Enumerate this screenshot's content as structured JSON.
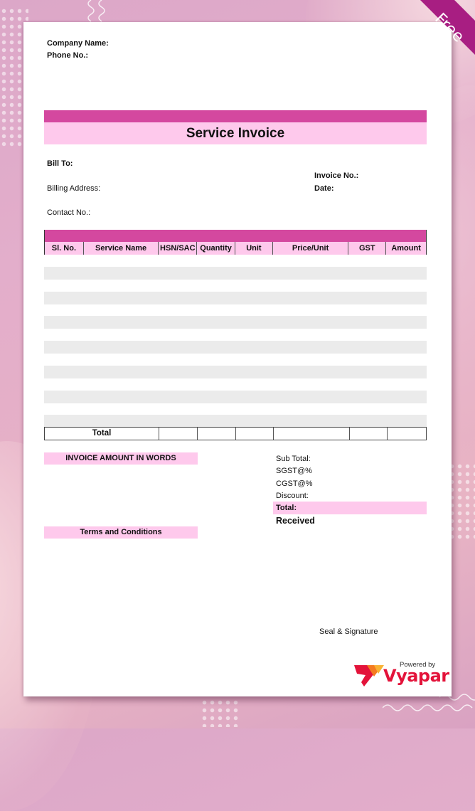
{
  "ribbon": {
    "label": "Free"
  },
  "header": {
    "company_name_label": "Company Name:",
    "phone_label": "Phone No.:"
  },
  "title": "Service Invoice",
  "billing": {
    "bill_to_label": "Bill To:",
    "billing_address_label": "Billing Address:",
    "contact_label": "Contact No.:",
    "invoice_no_label": "Invoice No.:",
    "date_label": "Date:"
  },
  "table": {
    "columns": [
      "Sl. No.",
      "Service Name",
      "HSN/SAC",
      "Quantity",
      "Unit",
      "Price/Unit",
      "GST",
      "Amount"
    ],
    "empty_rows": 7,
    "total_label": "Total"
  },
  "amount_in_words_label": "INVOICE AMOUNT IN WORDS",
  "terms_label": "Terms and Conditions",
  "summary": {
    "sub_total": "Sub Total:",
    "sgst": "SGST@%",
    "cgst": "CGST@%",
    "discount": "Discount:",
    "total": "Total:",
    "received": "Received"
  },
  "signature_label": "Seal & Signature",
  "branding": {
    "powered_by": "Powered by",
    "brand_name": "Vyapar",
    "brand_color": "#e3133a"
  },
  "colors": {
    "accent_dark": "#d4489f",
    "accent_light": "#fec9ec",
    "ribbon": "#a81e82",
    "row_shade": "#ebebeb"
  }
}
